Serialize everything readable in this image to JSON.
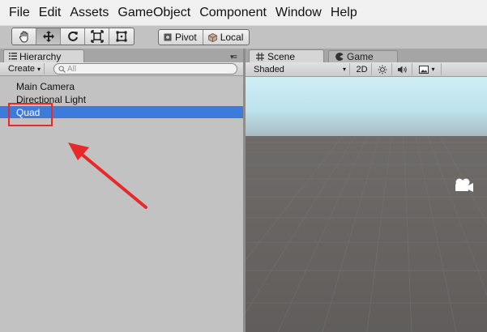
{
  "menu": [
    "File",
    "Edit",
    "Assets",
    "GameObject",
    "Component",
    "Window",
    "Help"
  ],
  "toolbar": {
    "tools": [
      "hand-icon",
      "move-icon",
      "rotate-icon",
      "scale-icon",
      "rect-icon"
    ],
    "active_tool": "move-icon",
    "pivot_label": "Pivot",
    "local_label": "Local"
  },
  "hierarchy": {
    "tab_label": "Hierarchy",
    "create_label": "Create",
    "search_placeholder": "All",
    "items": [
      {
        "label": "Main Camera",
        "selected": false
      },
      {
        "label": "Directional Light",
        "selected": false
      },
      {
        "label": "Quad",
        "selected": true
      }
    ]
  },
  "scene": {
    "tab_label": "Scene",
    "game_tab_label": "Game",
    "draw_mode": "Shaded",
    "mode_2d": "2D"
  },
  "colors": {
    "selection": "#3d7bdb",
    "annotation": "#e8282b",
    "panel_bg": "#c2c2c2"
  }
}
